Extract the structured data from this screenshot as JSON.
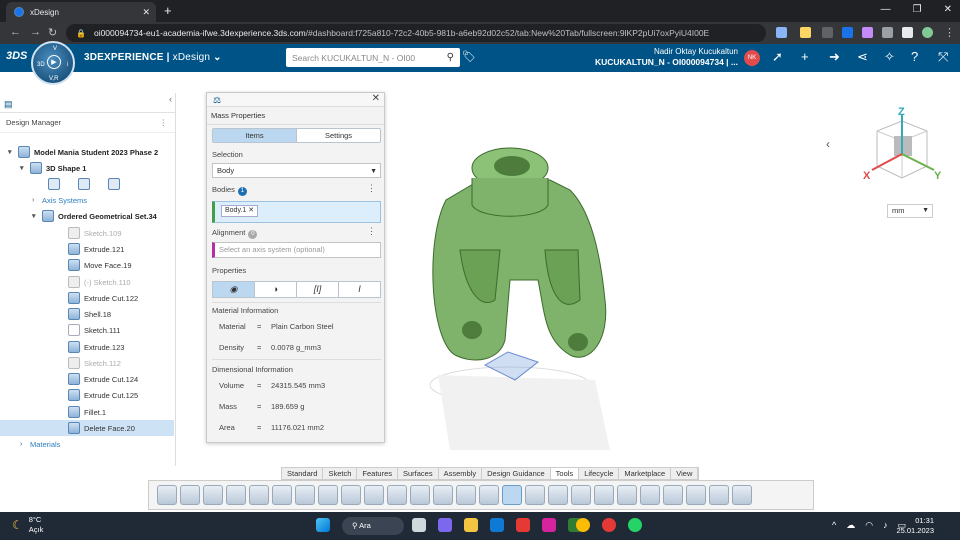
{
  "browser": {
    "tab_title": "xDesign",
    "url_host": "oi000094734-eu1-academia-ifwe.3dexperience.3ds.com",
    "url_rest": "/#dashboard:f725a810-72c2-40b5-981b-a6eb92d02c52/tab:New%20Tab/fullscreen:9lKP2pUi7oxPyiU4I00E"
  },
  "header": {
    "brand": "3DEXPERIENCE",
    "app": "xDesign",
    "search_placeholder": "Search KUCUKALTUN_N - OI00",
    "user_name": "Nadir Oktay Kucukaltun",
    "tenant": "KUCUKALTUN_N - OI000094734 | ...",
    "avatar": "NK",
    "compass_v": "V",
    "compass_r": "V,R",
    "compass_3d": "3D",
    "compass_i": "i"
  },
  "design_manager": {
    "title": "Design Manager",
    "items": [
      {
        "label": "Model Mania Student 2023 Phase 2",
        "style": "bold",
        "arrow": "▾",
        "indent": 8
      },
      {
        "label": "3D Shape 1",
        "style": "bold",
        "arrow": "▾",
        "indent": 20
      },
      {
        "label": "Axis Systems",
        "style": "link",
        "arrow": "›",
        "indent": 32
      },
      {
        "label": "Ordered Geometrical Set.34",
        "style": "bold",
        "arrow": "▾",
        "indent": 32
      },
      {
        "label": "Sketch.109",
        "style": "disabled",
        "arrow": "",
        "indent": 58
      },
      {
        "label": "Extrude.121",
        "style": "",
        "arrow": "",
        "indent": 58
      },
      {
        "label": "Move Face.19",
        "style": "",
        "arrow": "",
        "indent": 58
      },
      {
        "label": "(-)  Sketch.110",
        "style": "disabled",
        "arrow": "",
        "indent": 58
      },
      {
        "label": "Extrude Cut.122",
        "style": "",
        "arrow": "",
        "indent": 58
      },
      {
        "label": "Shell.18",
        "style": "",
        "arrow": "",
        "indent": 58
      },
      {
        "label": "Sketch.111",
        "style": "",
        "arrow": "",
        "indent": 58
      },
      {
        "label": "Extrude.123",
        "style": "",
        "arrow": "",
        "indent": 58
      },
      {
        "label": "Sketch.112",
        "style": "disabled",
        "arrow": "",
        "indent": 58
      },
      {
        "label": "Extrude Cut.124",
        "style": "",
        "arrow": "",
        "indent": 58
      },
      {
        "label": "Extrude Cut.125",
        "style": "",
        "arrow": "",
        "indent": 58
      },
      {
        "label": "Fillet.1",
        "style": "",
        "arrow": "",
        "indent": 58
      },
      {
        "label": "Delete Face.20",
        "style": "selected",
        "arrow": "",
        "indent": 58
      },
      {
        "label": "Materials",
        "style": "link",
        "arrow": "›",
        "indent": 20
      }
    ]
  },
  "mass_properties": {
    "title": "Mass Properties",
    "tab_items": "Items",
    "tab_settings": "Settings",
    "selection_label": "Selection",
    "selection_value": "Body",
    "bodies_label": "Bodies",
    "bodies_count": "1",
    "body_chip": "Body.1",
    "alignment_label": "Alignment",
    "alignment_count": "0",
    "alignment_placeholder": "Select an axis system (optional)",
    "properties_label": "Properties",
    "material_info_label": "Material Information",
    "material_key": "Material",
    "material_value": "Plain Carbon Steel",
    "density_key": "Density",
    "density_value": "0.0078 g_mm3",
    "dimensional_info_label": "Dimensional Information",
    "volume_key": "Volume",
    "volume_value": "24315.545 mm3",
    "mass_key": "Mass",
    "mass_value": "189.659 g",
    "area_key": "Area",
    "area_value": "11176.021 mm2",
    "eq": "="
  },
  "view": {
    "unit": "mm",
    "axis_x": "X",
    "axis_y": "Y",
    "axis_z": "Z"
  },
  "bottom_tabs": [
    "Standard",
    "Sketch",
    "Features",
    "Surfaces",
    "Assembly",
    "Design Guidance",
    "Tools",
    "Lifecycle",
    "Marketplace",
    "View"
  ],
  "active_tab": "Tools",
  "taskbar": {
    "temp": "8°C",
    "condition": "Açık",
    "search": "Ara",
    "time": "01:31",
    "date": "25.01.2023"
  },
  "colors": {
    "header_blue": "#005386",
    "model_green": "#7fb26a",
    "accent": "#1f6fb5"
  }
}
